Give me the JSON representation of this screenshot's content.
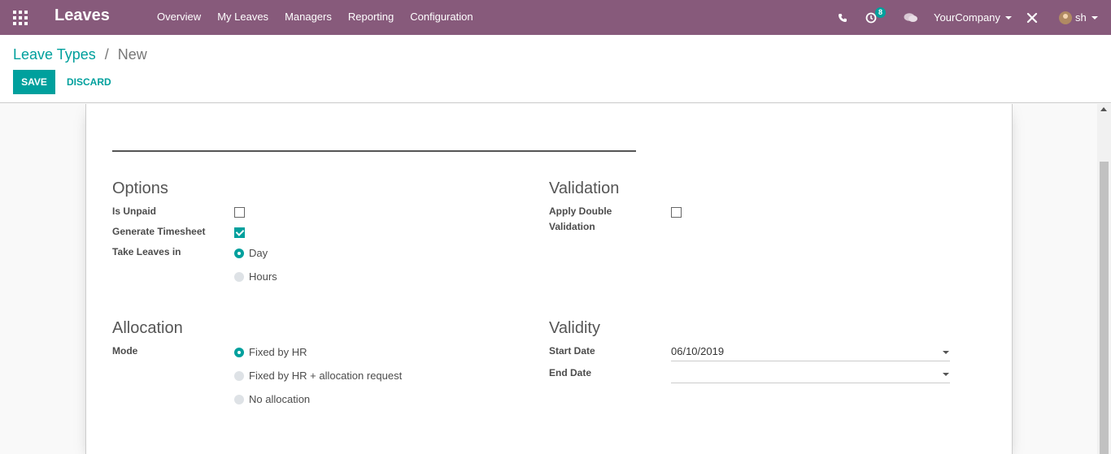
{
  "navbar": {
    "app_title": "Leaves",
    "menu": [
      "Overview",
      "My Leaves",
      "Managers",
      "Reporting",
      "Configuration"
    ],
    "activity_count": "8",
    "company": "YourCompany",
    "user": "sh"
  },
  "breadcrumb": {
    "parent": "Leave Types",
    "separator": "/",
    "current": "New"
  },
  "buttons": {
    "save": "SAVE",
    "discard": "DISCARD"
  },
  "form": {
    "name_value": "",
    "options": {
      "title": "Options",
      "is_unpaid_label": "Is Unpaid",
      "is_unpaid": false,
      "generate_timesheet_label": "Generate Timesheet",
      "generate_timesheet": true,
      "take_leaves_in_label": "Take Leaves in",
      "take_leaves_in_options": [
        "Day",
        "Hours"
      ],
      "take_leaves_in_selected": "Day"
    },
    "validation": {
      "title": "Validation",
      "double_validation_label_line1": "Apply Double",
      "double_validation_label_line2": "Validation",
      "double_validation": false
    },
    "allocation": {
      "title": "Allocation",
      "mode_label": "Mode",
      "mode_options": [
        "Fixed by HR",
        "Fixed by HR + allocation request",
        "No allocation"
      ],
      "mode_selected": "Fixed by HR"
    },
    "validity": {
      "title": "Validity",
      "start_date_label": "Start Date",
      "start_date_value": "06/10/2019",
      "end_date_label": "End Date",
      "end_date_value": ""
    }
  },
  "colors": {
    "navbar": "#875a7b",
    "accent": "#00a09d"
  }
}
